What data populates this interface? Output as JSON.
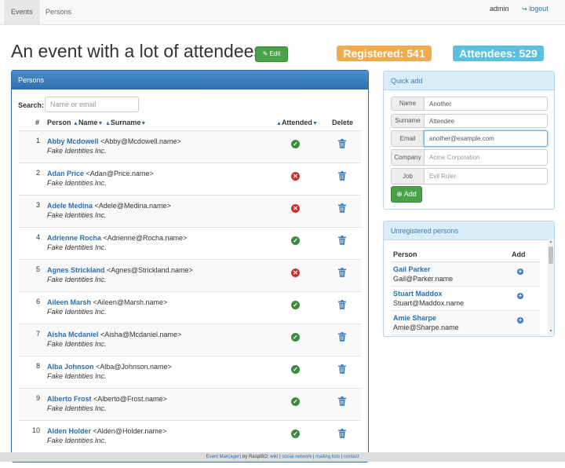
{
  "nav": {
    "tabs": [
      {
        "label": "Events",
        "active": true
      },
      {
        "label": "Persons",
        "active": false
      }
    ],
    "user": "admin",
    "logout_label": "logout"
  },
  "header": {
    "title": "An event with a lot of attendees",
    "edit_label": "Edit",
    "registered": "Registered: 541",
    "attendees": "Attendees: 529"
  },
  "persons_panel": {
    "title": "Persons",
    "search_label": "Search:",
    "search_placeholder": "Name or email",
    "columns": {
      "num": "#",
      "person": "Person",
      "name": "Name",
      "surname": "Surname",
      "attended": "Attended",
      "delete": "Delete"
    },
    "rows": [
      {
        "num": "1",
        "name": "Abby Mcdowell",
        "email": "<Abby@Mcdowell.name>",
        "org": "Fake Identities Inc.",
        "attended": true
      },
      {
        "num": "2",
        "name": "Adan Price",
        "email": "<Adan@Price.name>",
        "org": "Fake Identities Inc.",
        "attended": false
      },
      {
        "num": "3",
        "name": "Adele Medina",
        "email": "<Adele@Medina.name>",
        "org": "Fake Identities Inc.",
        "attended": false
      },
      {
        "num": "4",
        "name": "Adrienne Rocha",
        "email": "<Adrienne@Rocha.name>",
        "org": "Fake Identities Inc.",
        "attended": true
      },
      {
        "num": "5",
        "name": "Agnes Strickland",
        "email": "<Agnes@Strickland.name>",
        "org": "Fake Identities Inc.",
        "attended": false
      },
      {
        "num": "6",
        "name": "Aileen Marsh",
        "email": "<Aileen@Marsh.name>",
        "org": "Fake Identities Inc.",
        "attended": true
      },
      {
        "num": "7",
        "name": "Aisha Mcdaniel",
        "email": "<Aisha@Mcdaniel.name>",
        "org": "Fake Identities Inc.",
        "attended": true
      },
      {
        "num": "8",
        "name": "Alba Johnson",
        "email": "<Alba@Johnson.name>",
        "org": "Fake Identities Inc.",
        "attended": true
      },
      {
        "num": "9",
        "name": "Alberto Frost",
        "email": "<Alberto@Frost.name>",
        "org": "Fake Identities Inc.",
        "attended": true
      },
      {
        "num": "10",
        "name": "Alden Holder",
        "email": "<Alden@Holder.name>",
        "org": "Fake Identities Inc.",
        "attended": true
      }
    ]
  },
  "quick_add": {
    "title": "Quick add",
    "fields": [
      {
        "label": "Name",
        "value": "Another",
        "placeholder": ""
      },
      {
        "label": "Surname",
        "value": "Attendee",
        "placeholder": ""
      },
      {
        "label": "Email",
        "value": "another@example.com",
        "placeholder": ""
      },
      {
        "label": "Company",
        "value": "",
        "placeholder": "Acme Corporation"
      },
      {
        "label": "Job",
        "value": "",
        "placeholder": "Evil Ruler"
      }
    ],
    "add_label": "Add"
  },
  "unregistered": {
    "title": "Unregistered persons",
    "col_person": "Person",
    "col_add": "Add",
    "rows": [
      {
        "name": "Gail Parker",
        "email": "Gail@Parker.name"
      },
      {
        "name": "Stuart Maddox",
        "email": "Stuart@Maddox.name"
      },
      {
        "name": "Amie Sharpe",
        "email": "Amie@Sharpe.name"
      }
    ]
  },
  "footer": {
    "app_link": "Event Man(ager)",
    "by_text": "by RaspiBO:",
    "links": [
      "wiki",
      "social network",
      "mailing lists",
      "contact"
    ]
  },
  "colors": {
    "primary": "#3a7ebf",
    "success": "#48a348",
    "warning": "#f0ac4c",
    "info": "#5bc0de",
    "danger": "#c9302c"
  }
}
